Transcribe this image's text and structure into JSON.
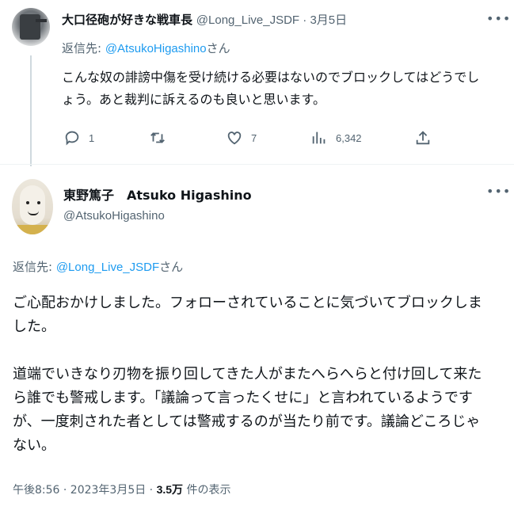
{
  "reply_tweet": {
    "display_name": "大口径砲が好きな戦車長",
    "handle": "@Long_Live_JSDF",
    "separator": " · ",
    "date": "3月5日",
    "replying_prefix": "返信先: ",
    "replying_to": "@AtsukoHigashino",
    "replying_suffix": "さん",
    "text_line1": "こんな奴の誹謗中傷を受け続ける必要はないのでブロックしてはどうでし",
    "text_line2": "ょう。あと裁判に訴えるのも良いと思います。",
    "actions": {
      "reply_count": "1",
      "retweet_count": "",
      "like_count": "7",
      "views_count": "6,342"
    },
    "avatar_icon": "tank-avatar"
  },
  "main_tweet": {
    "display_name": "東野篤子　Atsuko Higashino",
    "handle": "@AtsukoHigashino",
    "replying_prefix": "返信先: ",
    "replying_to": "@Long_Live_JSDF",
    "replying_suffix": "さん",
    "paragraph1_line1": "ご心配おかけしました。フォローされていることに気づいてブロックしま",
    "paragraph1_line2": "した。",
    "paragraph2_line1": "道端でいきなり刃物を振り回してきた人がまたへらへらと付け回して来た",
    "paragraph2_line2": "ら誰でも警戒します。「議論って言ったくせに」と言われているようです",
    "paragraph2_line3": "が、一度刺された者としては警戒するのが当たり前です。議論どころじゃ",
    "paragraph2_line4": "ない。",
    "timestamp": "午後8:56 · 2023年3月5日 · ",
    "views_value": "3.5万",
    "views_suffix": " 件の表示",
    "avatar_icon": "character-avatar"
  },
  "icons": {
    "more": "more-icon",
    "reply": "reply-icon",
    "retweet": "retweet-icon",
    "like": "heart-icon",
    "views": "views-icon",
    "share": "share-icon"
  },
  "colors": {
    "text": "#0f1419",
    "secondary": "#536471",
    "link": "#1d9bf0",
    "divider": "#eff3f4"
  }
}
